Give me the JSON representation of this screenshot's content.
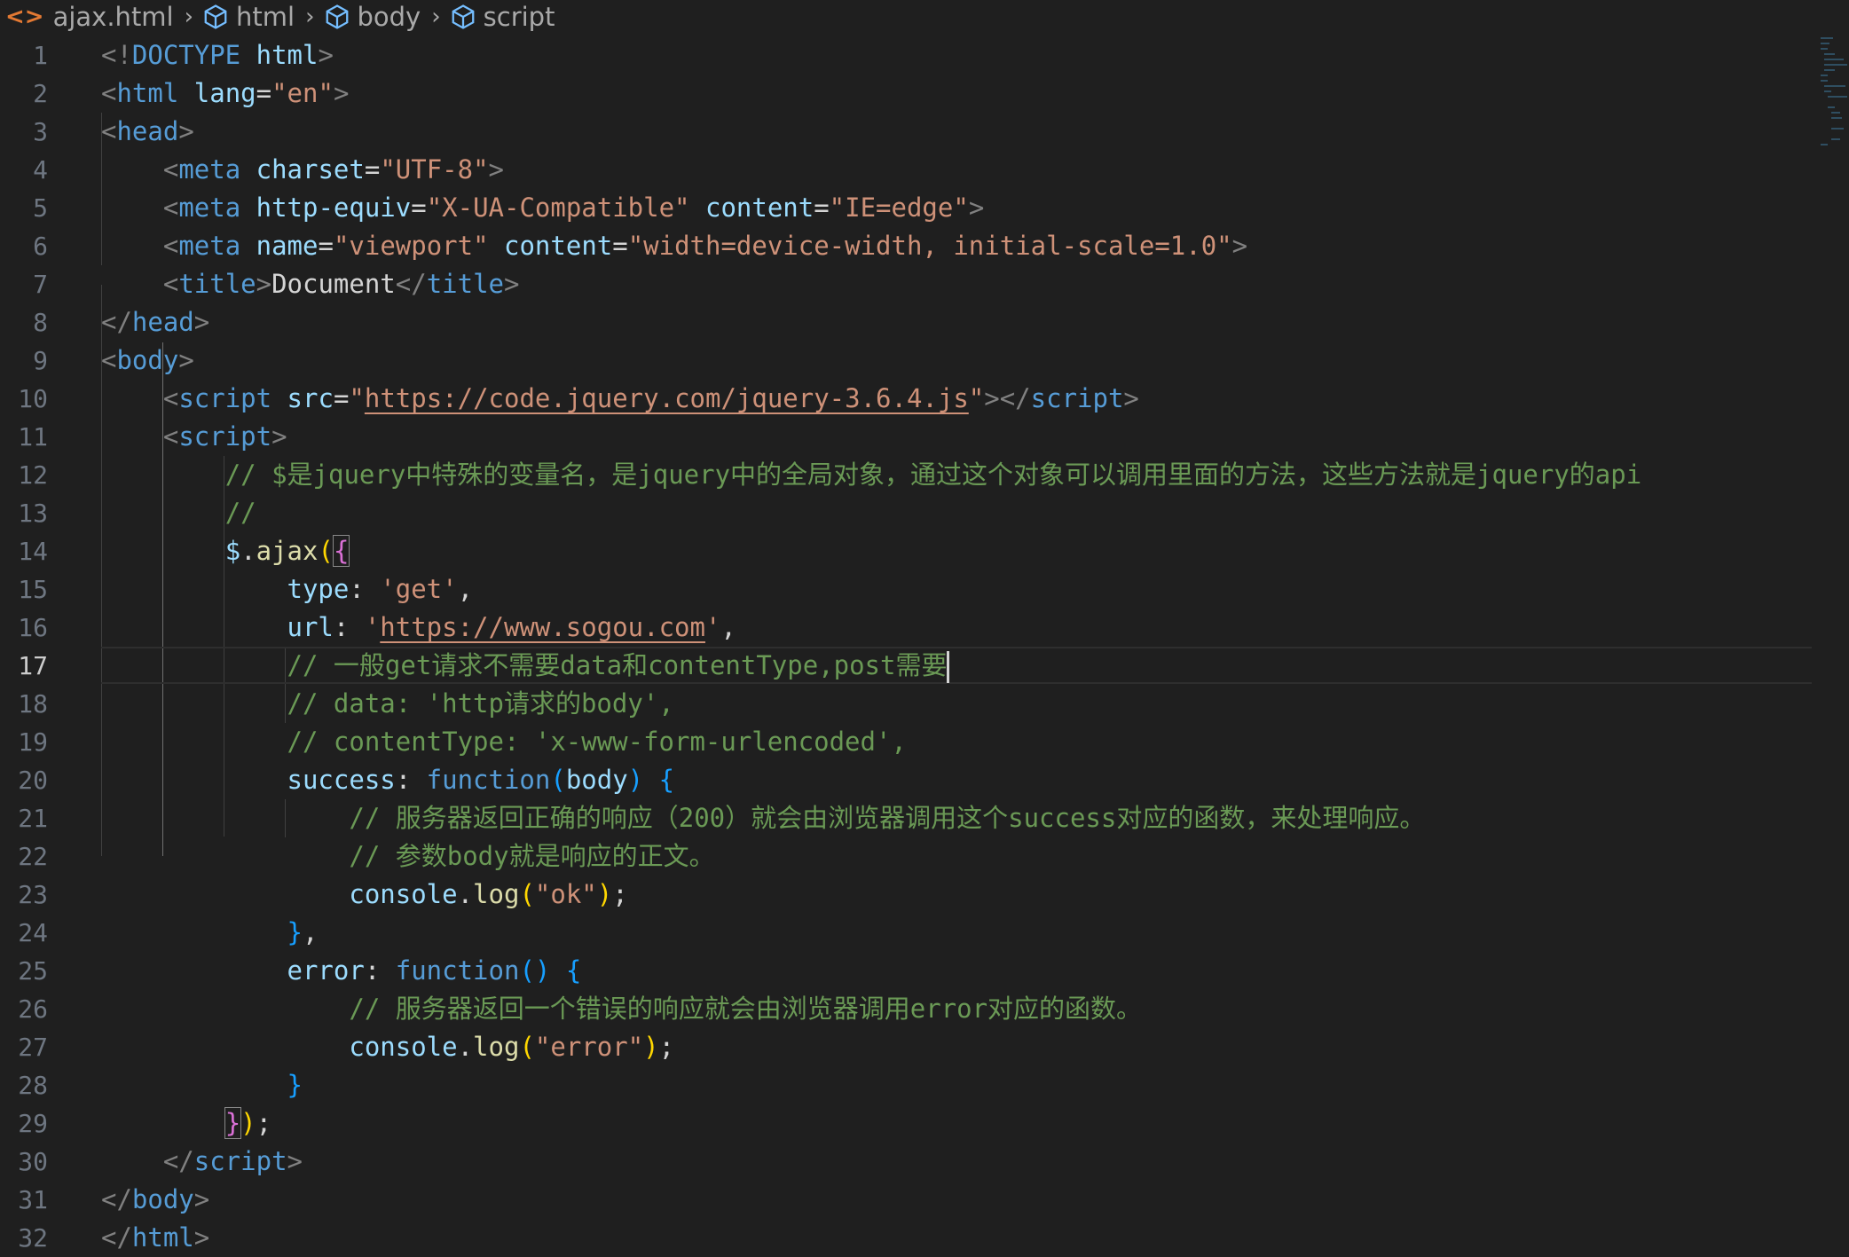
{
  "breadcrumb": {
    "file": "ajax.html",
    "path": [
      "html",
      "body",
      "script"
    ]
  },
  "editor": {
    "active_line": 17,
    "line_numbers": [
      "1",
      "2",
      "3",
      "4",
      "5",
      "6",
      "7",
      "8",
      "9",
      "10",
      "11",
      "12",
      "13",
      "14",
      "15",
      "16",
      "17",
      "18",
      "19",
      "20",
      "21",
      "22",
      "23",
      "24",
      "25",
      "26",
      "27",
      "28",
      "29",
      "30",
      "31",
      "32"
    ],
    "urls": {
      "jquery": "https://code.jquery.com/jquery-3.6.4.js",
      "sogou": "https://www.sogou.com"
    },
    "comments": {
      "l12": "// $是jquery中特殊的变量名，是jquery中的全局对象，通过这个对象可以调用里面的方法，这些方法就是jquery的api",
      "l13": "//",
      "l17": "// 一般get请求不需要data和contentType,post需要",
      "l18": "// data: 'http请求的body',",
      "l19": "// contentType: 'x-www-form-urlencoded',",
      "l21": "// 服务器返回正确的响应（200）就会由浏览器调用这个success对应的函数，来处理响应。",
      "l22": "// 参数body就是响应的正文。",
      "l26": "// 服务器返回一个错误的响应就会由浏览器调用error对应的函数。"
    }
  },
  "colors": {
    "background": "#1f1f1f",
    "tag": "#569cd6",
    "attribute": "#9cdcfe",
    "string": "#ce9178",
    "comment": "#6a9955",
    "bracket_gold": "#ffd700",
    "bracket_purple": "#da70d6",
    "bracket_blue": "#179fff"
  }
}
